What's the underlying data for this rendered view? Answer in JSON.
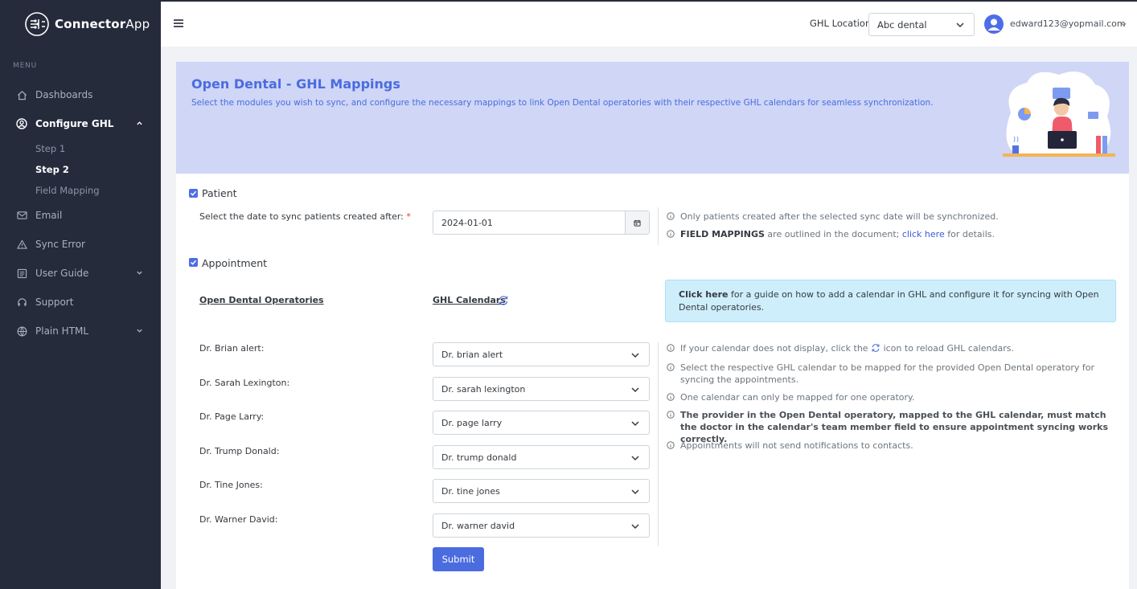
{
  "brand": {
    "name_bold": "Connector",
    "name_light": "App"
  },
  "sidebar": {
    "menu_title": "MENU",
    "items": [
      {
        "label": "Dashboards",
        "icon": "home-icon"
      },
      {
        "label": "Configure GHL",
        "icon": "user-circle-icon",
        "expanded": true,
        "children": [
          {
            "label": "Step 1"
          },
          {
            "label": "Step 2",
            "active": true
          },
          {
            "label": "Field Mapping"
          }
        ]
      },
      {
        "label": "Email",
        "icon": "mail-icon"
      },
      {
        "label": "Sync Error",
        "icon": "warning-icon"
      },
      {
        "label": "User Guide",
        "icon": "document-icon"
      },
      {
        "label": "Support",
        "icon": "headset-icon"
      },
      {
        "label": "Plain HTML",
        "icon": "globe-icon"
      }
    ]
  },
  "topbar": {
    "location_label": "GHL Location:",
    "location_value": "Abc dental",
    "user_email": "edward123@yopmail.com"
  },
  "banner": {
    "title": "Open Dental - GHL Mappings",
    "description": "Select the modules you wish to sync, and configure the necessary mappings to link Open Dental operatories with their respective GHL calendars for seamless synchronization."
  },
  "patient": {
    "label": "Patient",
    "checked": true,
    "date_label": "Select the date to sync patients created after:",
    "required_mark": "*",
    "date_value": "2024-01-01",
    "note1": "Only patients created after the selected sync date will be synchronized.",
    "note2_bold": "FIELD MAPPINGS",
    "note2_text": " are outlined in the document; ",
    "note2_link": "click here",
    "note2_tail": " for details."
  },
  "appointment": {
    "label": "Appointment",
    "checked": true,
    "col_operatories": "Open Dental Operatories",
    "col_calendars": "GHL Calendars",
    "alert_link": "Click here",
    "alert_text": " for a guide on how to add a calendar in GHL and configure it for syncing with Open Dental operatories.",
    "mappings": [
      {
        "operatory": "Dr. Brian alert:",
        "calendar": "Dr. brian alert"
      },
      {
        "operatory": "Dr. Sarah Lexington:",
        "calendar": "Dr. sarah lexington"
      },
      {
        "operatory": "Dr. Page Larry:",
        "calendar": "Dr. page larry"
      },
      {
        "operatory": "Dr. Trump Donald:",
        "calendar": "Dr. trump donald"
      },
      {
        "operatory": "Dr. Tine Jones:",
        "calendar": "Dr. tine jones"
      },
      {
        "operatory": "Dr. Warner David:",
        "calendar": "Dr. warner david"
      }
    ],
    "notes": {
      "n1_before": "If your calendar does not display, click the",
      "n1_after": "icon to reload GHL calendars.",
      "n2": "Select the respective GHL calendar to be mapped for the provided Open Dental operatory for syncing the appointments.",
      "n3": "One calendar can only be mapped for one operatory.",
      "n4": "The provider in the Open Dental operatory, mapped to the GHL calendar, must match the doctor in the calendar's team member field to ensure appointment syncing works correctly.",
      "n5": "Appointments will not send notifications to contacts."
    },
    "submit_label": "Submit"
  },
  "colors": {
    "sidebar_bg": "#262b3c",
    "accent": "#4a6cdf",
    "banner_bg": "#cfd6f6",
    "alert_bg": "#cfeefb"
  }
}
